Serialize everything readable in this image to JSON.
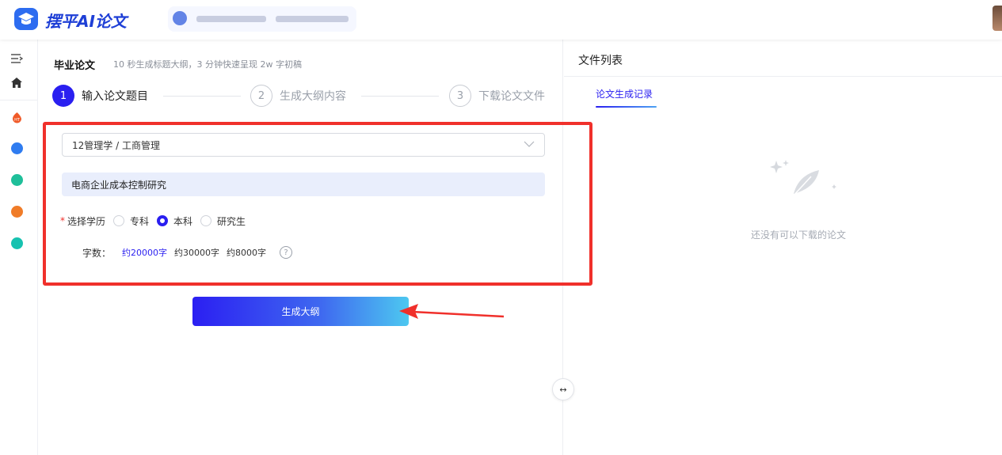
{
  "header": {
    "app_title": "摆平AI论文",
    "logo_icon": "graduation-cap-icon"
  },
  "sidebar": {
    "items": [
      {
        "icon": "menu-collapse-icon"
      },
      {
        "icon": "home-icon"
      },
      {
        "icon": "hot-tool-icon"
      },
      {
        "icon": "document-tool-icon"
      },
      {
        "icon": "green-tool-icon"
      },
      {
        "icon": "orange-tool-icon"
      },
      {
        "icon": "teal-tool-icon"
      }
    ]
  },
  "main": {
    "title": "毕业论文",
    "subtitle": "10 秒生成标题大纲，3 分钟快速呈现 2w 字初稿",
    "steps": [
      {
        "num": "1",
        "label": "输入论文题目",
        "active": true
      },
      {
        "num": "2",
        "label": "生成大纲内容",
        "active": false
      },
      {
        "num": "3",
        "label": "下载论文文件",
        "active": false
      }
    ],
    "form": {
      "subject_select": "12管理学 / 工商管理",
      "topic_value": "电商企业成本控制研究",
      "education_label": "选择学历",
      "education_required_mark": "*",
      "education_options": [
        "专科",
        "本科",
        "研究生"
      ],
      "education_selected": "本科",
      "words_label": "字数：",
      "word_options": [
        "约20000字",
        "约30000字",
        "约8000字"
      ],
      "words_selected": "约20000字",
      "help_glyph": "?"
    },
    "generate_button": "生成大纲",
    "resize_glyph": "↔"
  },
  "right_panel": {
    "title": "文件列表",
    "tab": "论文生成记录",
    "empty_text": "还没有可以下载的论文"
  },
  "colors": {
    "accent": "#2a1ff0",
    "highlight_border": "#f0302b",
    "input_bg": "#e9eefc"
  }
}
